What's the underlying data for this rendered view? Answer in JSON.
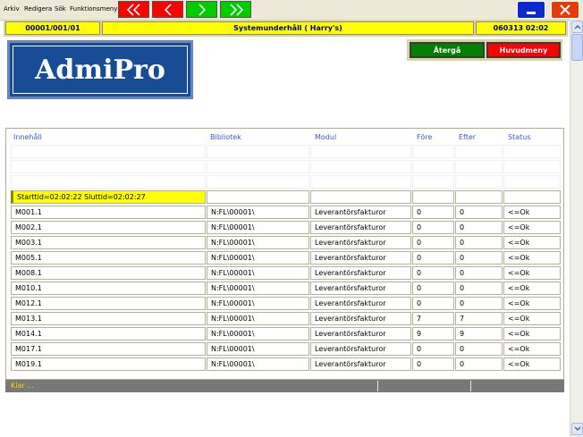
{
  "menu": {
    "items": [
      "Arkiv",
      "Redigera",
      "Sök",
      "Funktionsmeny"
    ]
  },
  "nav": {
    "first": "first-icon",
    "prev": "prev-icon",
    "next": "next-icon",
    "last": "last-icon"
  },
  "window": {
    "minimize": "minimize-icon",
    "close": "close-icon"
  },
  "header": {
    "id": "00001/001/01",
    "title": "Systemunderhåll ( Harry's)",
    "datetime": "060313 02:02"
  },
  "logo": {
    "text": "AdmiPro"
  },
  "actions": {
    "back_label": "Återgå",
    "main_menu_label": "Huvudmeny"
  },
  "table": {
    "columns": [
      "Innehåll",
      "Bibliotek",
      "Modul",
      "Före",
      "Efter",
      "Status"
    ],
    "start_row": "Starttid=02:02:22  Sluttid=02:02:27",
    "rows": [
      [
        "M001.1",
        "N:FL\\00001\\",
        "Leverantörsfakturor",
        "0",
        "0",
        "<=Ok"
      ],
      [
        "M002.1",
        "N:FL\\00001\\",
        "Leverantörsfakturor",
        "0",
        "0",
        "<=Ok"
      ],
      [
        "M003.1",
        "N:FL\\00001\\",
        "Leverantörsfakturor",
        "0",
        "0",
        "<=Ok"
      ],
      [
        "M005.1",
        "N:FL\\00001\\",
        "Leverantörsfakturor",
        "0",
        "0",
        "<=Ok"
      ],
      [
        "M008.1",
        "N:FL\\00001\\",
        "Leverantörsfakturor",
        "0",
        "0",
        "<=Ok"
      ],
      [
        "M010.1",
        "N:FL\\00001\\",
        "Leverantörsfakturor",
        "0",
        "0",
        "<=Ok"
      ],
      [
        "M012.1",
        "N:FL\\00001\\",
        "Leverantörsfakturor",
        "0",
        "0",
        "<=Ok"
      ],
      [
        "M013.1",
        "N:FL\\00001\\",
        "Leverantörsfakturor",
        "7",
        "7",
        "<=Ok"
      ],
      [
        "M014.1",
        "N:FL\\00001\\",
        "Leverantörsfakturor",
        "9",
        "9",
        "<=Ok"
      ],
      [
        "M017.1",
        "N:FL\\00001\\",
        "Leverantörsfakturor",
        "0",
        "0",
        "<=Ok"
      ],
      [
        "M019.1",
        "N:FL\\00001\\",
        "Leverantörsfakturor",
        "0",
        "0",
        "<=Ok"
      ]
    ]
  },
  "status": {
    "text": "Klar ..."
  },
  "colors": {
    "header_bg": "#ffff00",
    "header_text": "#000080",
    "nav_red": "#ff0000",
    "nav_green": "#00cc00",
    "back_button": "#008000",
    "main_menu_button": "#ff0000",
    "logo_bg": "#184c94",
    "column_header": "#3c5cc8",
    "status_text": "#ffd800"
  }
}
